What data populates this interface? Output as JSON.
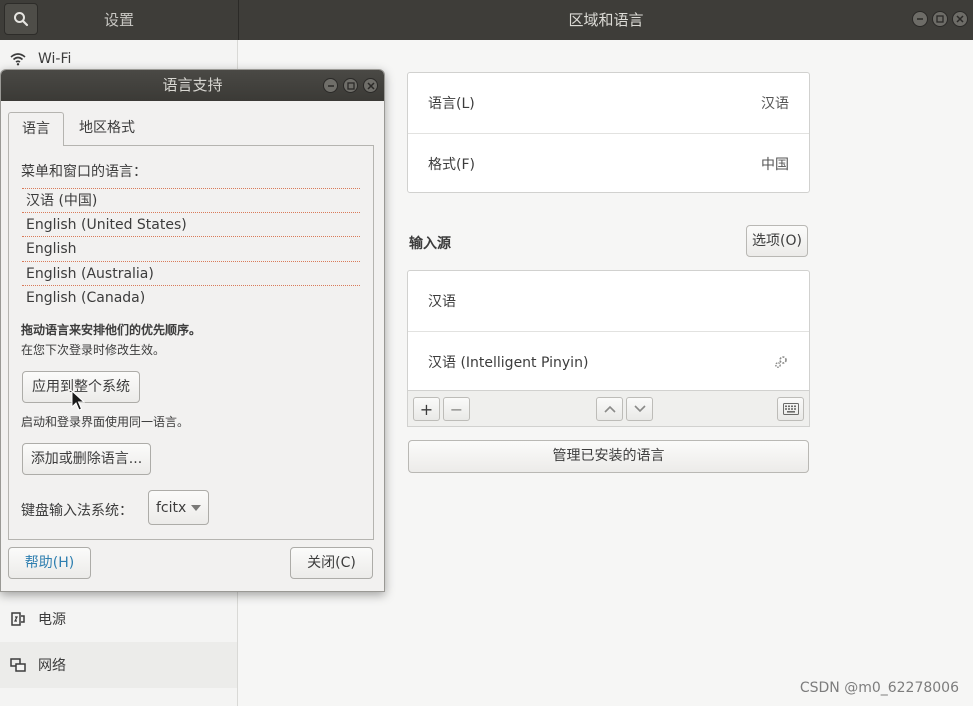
{
  "settings": {
    "sidebar_title": "设置",
    "main_title": "区域和语言",
    "sidebar_items": [
      {
        "label": "Wi-Fi",
        "icon": "wifi-icon"
      },
      {
        "label": "电源",
        "icon": "power-icon"
      },
      {
        "label": "网络",
        "icon": "network-icon"
      }
    ]
  },
  "region": {
    "rows": [
      {
        "label": "语言(L)",
        "value": "汉语"
      },
      {
        "label": "格式(F)",
        "value": "中国"
      }
    ],
    "input_sources_title": "输入源",
    "options_button": "选项(O)",
    "input_sources": [
      {
        "label": "汉语"
      },
      {
        "label": "汉语 (Intelligent Pinyin)"
      }
    ],
    "toolbar": {
      "add": "+",
      "remove": "−"
    },
    "manage_button": "管理已安装的语言"
  },
  "dialog": {
    "title": "语言支持",
    "tabs": [
      "语言",
      "地区格式"
    ],
    "menu_lang_label": "菜单和窗口的语言：",
    "languages": [
      "汉语 (中国)",
      "English (United States)",
      "English",
      "English (Australia)",
      "English (Canada)"
    ],
    "drag_hint_bold": "拖动语言来安排他们的优先顺序。",
    "drag_hint": "在您下次登录时修改生效。",
    "apply_button": "应用到整个系统",
    "apply_hint": "启动和登录界面使用同一语言。",
    "add_remove_button": "添加或删除语言...",
    "im_label": "键盘输入法系统：",
    "im_value": "fcitx",
    "help_button": "帮助(H)",
    "close_button": "关闭(C)"
  },
  "watermark": "CSDN @m0_62278006",
  "colors": {
    "header": "#3e3d39",
    "help_text": "#2f7fb0"
  }
}
